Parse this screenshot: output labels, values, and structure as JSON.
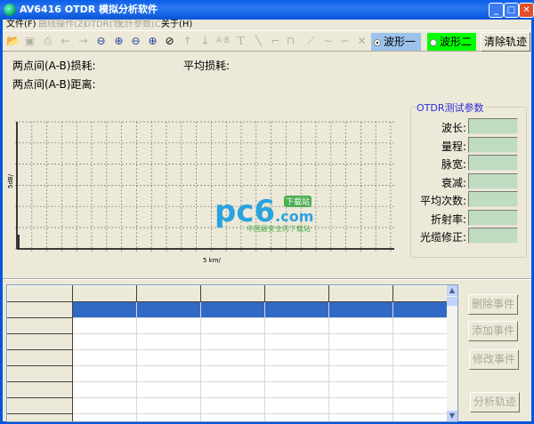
{
  "window": {
    "title": "AV6416 OTDR 模拟分析软件"
  },
  "menu": [
    {
      "label": "文件(F)",
      "enabled": true
    },
    {
      "label": "曲线操作(Z)",
      "enabled": false
    },
    {
      "label": "OTDR(T)",
      "enabled": false
    },
    {
      "label": "光纤参数(C)",
      "enabled": false
    },
    {
      "label": "关于(H)",
      "enabled": true
    }
  ],
  "toolbar": {
    "icons": [
      "open-icon",
      "save-icon",
      "print-icon",
      "arrow-left-icon",
      "arrow-right-icon",
      "zoom-out-vertical-icon",
      "zoom-in-vertical-icon",
      "zoom-out-horizontal-icon",
      "zoom-in-horizontal-icon",
      "zoom-reset-icon",
      "arrow-up-icon",
      "arrow-down-icon",
      "a-b-icon",
      "text-icon",
      "line-icon",
      "step-down-icon",
      "pulse-icon",
      "curve-icon",
      "event-up-icon",
      "event-down-icon",
      "cross-icon"
    ],
    "wave1_label": "波形一",
    "wave2_label": "波形二",
    "clear_label": "清除轨迹",
    "wave1_color": "#9cc3ec",
    "wave2_color": "#00ff00"
  },
  "info": {
    "ab_loss_label": "两点间(A-B)损耗:",
    "avg_loss_label": "平均损耗:",
    "ab_distance_label": "两点间(A-B)距离:"
  },
  "chart": {
    "y_scale": "5dB/",
    "x_scale": "5 km/"
  },
  "params": {
    "title": "OTDR测试参数",
    "items": [
      {
        "label": "波长:",
        "value": ""
      },
      {
        "label": "量程:",
        "value": ""
      },
      {
        "label": "脉宽:",
        "value": ""
      },
      {
        "label": "衰减:",
        "value": ""
      },
      {
        "label": "平均次数:",
        "value": ""
      },
      {
        "label": "折射率:",
        "value": ""
      },
      {
        "label": "光缆修正:",
        "value": ""
      }
    ]
  },
  "buttons": {
    "delete_event": "删除事件",
    "add_event": "添加事件",
    "modify_event": "修改事件",
    "analyze": "分析轨迹"
  },
  "watermark": {
    "logo": "pc6.com",
    "tag": "下载站",
    "slogan": "中国最安全的下载站"
  }
}
